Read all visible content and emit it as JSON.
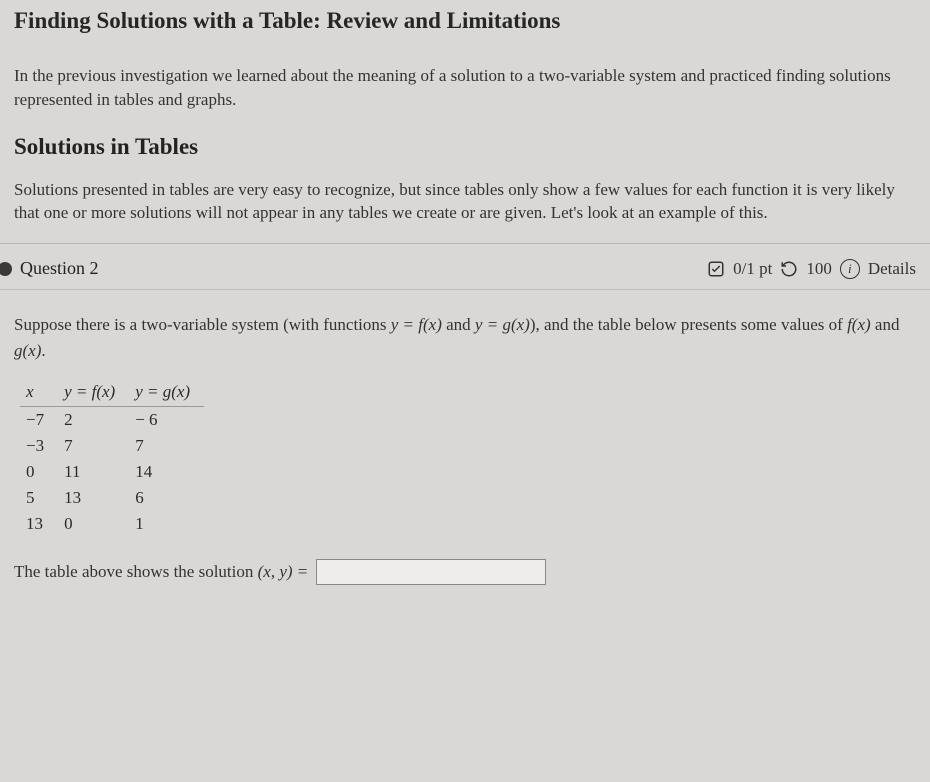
{
  "page_title": "Finding Solutions with a Table: Review and Limitations",
  "intro": "In the previous investigation we learned about the meaning of a solution to a two-variable system and practiced finding solutions represented in tables and graphs.",
  "sub_heading": "Solutions in Tables",
  "body": "Solutions presented in tables are very easy to recognize, but since tables only show a few values for each function it is very likely that one or more solutions will not appear in any tables we create or are given. Let's look at an example of this.",
  "question": {
    "label": "Question 2",
    "score": "0/1 pt",
    "retries": "100",
    "details_label": "Details",
    "prompt_a": "Suppose there is a two-variable system (with functions ",
    "prompt_b": " and ",
    "prompt_c": "), and the table below presents some values of ",
    "prompt_d": " and ",
    "prompt_e": ".",
    "eq_yfx": "y = f(x)",
    "eq_ygx": "y = g(x)",
    "fn_fx": "f(x)",
    "fn_gx": "g(x)",
    "answer_label_a": "The table above shows the solution ",
    "answer_pair": "(x, y) =",
    "answer_value": ""
  },
  "chart_data": {
    "type": "table",
    "columns": [
      "x",
      "y = f(x)",
      "y = g(x)"
    ],
    "rows": [
      {
        "x": "−7",
        "f": "2",
        "g": "− 6"
      },
      {
        "x": "−3",
        "f": "7",
        "g": "7"
      },
      {
        "x": "0",
        "f": "11",
        "g": "14"
      },
      {
        "x": "5",
        "f": "13",
        "g": "6"
      },
      {
        "x": "13",
        "f": "0",
        "g": "1"
      }
    ]
  }
}
